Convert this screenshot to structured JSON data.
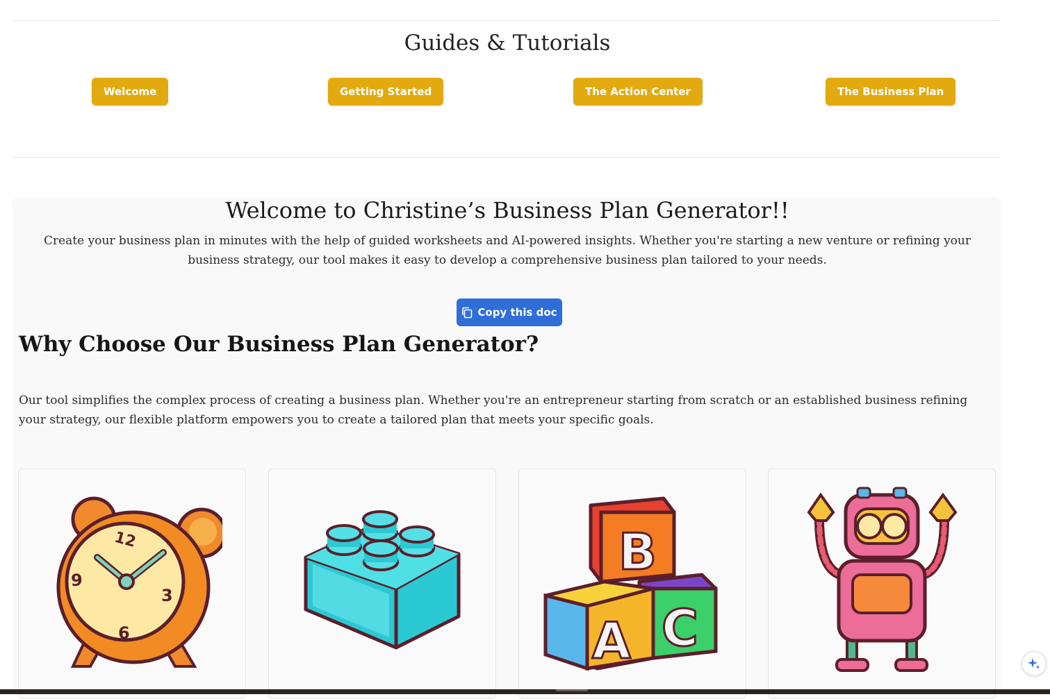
{
  "guides": {
    "title": "Guides & Tutorials",
    "buttons": [
      "Welcome",
      "Getting Started",
      "The Action Center",
      "The Business Plan"
    ],
    "button_color": "#e2aa0e"
  },
  "welcome": {
    "title": "Welcome to Christine’s Business Plan Generator!!",
    "intro": "Create your business plan in minutes with the help of guided worksheets and AI-powered insights. Whether you're starting a new venture or refining your business strategy, our tool makes it easy to develop a comprehensive business plan tailored to your needs.",
    "copy_button": "Copy this doc",
    "copy_icon": "copy-icon",
    "copy_color": "#2f6ed8"
  },
  "why": {
    "title": "Why Choose Our Business Plan Generator?",
    "text": "Our tool simplifies the complex process of creating a business plan. Whether you're an entrepreneur starting from scratch or an established business refining your strategy, our flexible platform empowers you to create a tailored plan that meets your specific goals."
  },
  "cards": [
    {
      "icon": "alarm-clock-illustration",
      "numerals": [
        "12",
        "3",
        "6",
        "9"
      ]
    },
    {
      "icon": "building-block-illustration"
    },
    {
      "icon": "abc-blocks-illustration",
      "letters": [
        "B",
        "A",
        "C"
      ]
    },
    {
      "icon": "robot-illustration"
    }
  ],
  "assistant_icon": "sparkle-icon"
}
